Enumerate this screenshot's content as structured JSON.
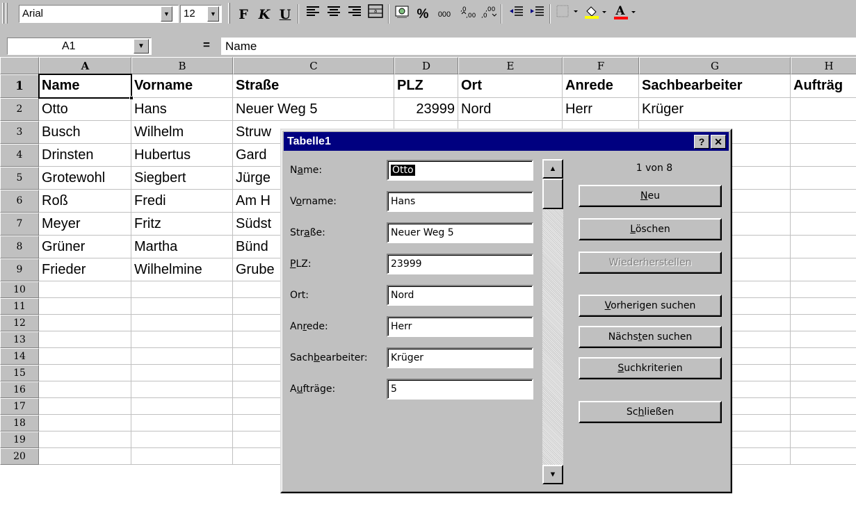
{
  "toolbar": {
    "font_name": "Arial",
    "font_size": "12",
    "bold_label": "F",
    "italic_label": "K",
    "underline_label": "U",
    "percent_label": "%",
    "thousands_label": "000",
    "inc_decimal_label": "⁺⁰⁰",
    "dec_decimal_label": "⁰⁰",
    "font_color_label": "A",
    "fill_color_accent": "#ffff00",
    "font_color_accent": "#ff0000"
  },
  "formula_bar": {
    "cell_ref": "A1",
    "equals": "=",
    "content": "Name"
  },
  "grid": {
    "columns": [
      "A",
      "B",
      "C",
      "D",
      "E",
      "F",
      "G",
      "H"
    ],
    "rows": [
      "1",
      "2",
      "3",
      "4",
      "5",
      "6",
      "7",
      "8",
      "9",
      "10",
      "11",
      "12",
      "13",
      "14",
      "15",
      "16",
      "17",
      "18",
      "19",
      "20"
    ],
    "header_row": [
      "Name",
      "Vorname",
      "Straße",
      "PLZ",
      "Ort",
      "Anrede",
      "Sachbearbeiter",
      "Aufträg"
    ],
    "data": [
      [
        "Otto",
        "Hans",
        "Neuer Weg 5",
        "23999",
        "Nord",
        "Herr",
        "Krüger",
        ""
      ],
      [
        "Busch",
        "Wilhelm",
        "Struw",
        "",
        "",
        "",
        "",
        ""
      ],
      [
        "Drinsten",
        "Hubertus",
        "Gard",
        "",
        "",
        "",
        "",
        ""
      ],
      [
        "Grotewohl",
        "Siegbert",
        "Jürge",
        "",
        "",
        "",
        "",
        ""
      ],
      [
        "Roß",
        "Fredi",
        "Am H",
        "",
        "",
        "",
        "",
        ""
      ],
      [
        "Meyer",
        "Fritz",
        "Südst",
        "",
        "",
        "",
        "",
        ""
      ],
      [
        "Grüner",
        "Martha",
        "Bünd",
        "",
        "",
        "",
        "",
        ""
      ],
      [
        "Frieder",
        "Wilhelmine",
        "Grube",
        "",
        "",
        "",
        "",
        ""
      ]
    ]
  },
  "dialog": {
    "title": "Tabelle1",
    "help_label": "?",
    "close_label": "✕",
    "record_counter": "1 von 8",
    "fields": [
      {
        "pre": "N",
        "u": "a",
        "post": "me:",
        "value": "Otto"
      },
      {
        "pre": "V",
        "u": "o",
        "post": "rname:",
        "value": "Hans"
      },
      {
        "pre": "Str",
        "u": "a",
        "post": "ße:",
        "value": "Neuer Weg 5"
      },
      {
        "pre": "",
        "u": "P",
        "post": "LZ:",
        "value": "23999"
      },
      {
        "pre": "Ort:",
        "u": "",
        "post": "",
        "value": "Nord"
      },
      {
        "pre": "An",
        "u": "r",
        "post": "ede:",
        "value": "Herr"
      },
      {
        "pre": "Sach",
        "u": "b",
        "post": "earbeiter:",
        "value": "Krüger"
      },
      {
        "pre": "A",
        "u": "u",
        "post": "fträge:",
        "value": "5"
      }
    ],
    "buttons": {
      "new": {
        "pre": "",
        "u": "N",
        "post": "eu"
      },
      "delete": {
        "pre": "",
        "u": "L",
        "post": "öschen"
      },
      "restore": {
        "pre": "Wiederherstellen",
        "u": "",
        "post": ""
      },
      "find_prev": {
        "pre": "",
        "u": "V",
        "post": "orherigen suchen"
      },
      "find_next": {
        "pre": "Nächs",
        "u": "t",
        "post": "en suchen"
      },
      "criteria": {
        "pre": "",
        "u": "S",
        "post": "uchkriterien"
      },
      "close": {
        "pre": "Sc",
        "u": "h",
        "post": "ließen"
      }
    }
  }
}
